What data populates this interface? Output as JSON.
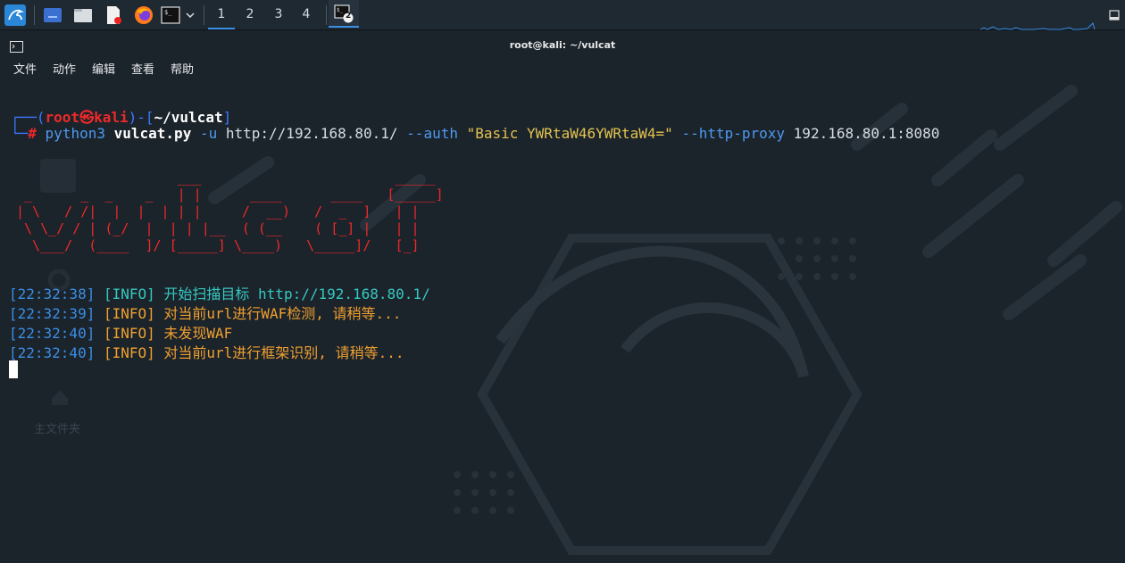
{
  "taskbar": {
    "workspaces": [
      "1",
      "2",
      "3",
      "4"
    ],
    "terminal_badge": "2",
    "icons": [
      "kali-dragon-icon",
      "desktop-icon",
      "file-manager-icon",
      "text-editor-icon",
      "firefox-icon",
      "terminal-icon",
      "chevron-down-icon",
      "terminal-task-icon"
    ]
  },
  "window": {
    "title": "root@kali: ~/vulcat",
    "icon": "terminal-window-icon"
  },
  "menu": [
    "文件",
    "动作",
    "编辑",
    "查看",
    "帮助"
  ],
  "prompt": {
    "corner_top": "┌──(",
    "user": "root",
    "skull": "㉿",
    "host": "kali",
    "mid": ")-[",
    "path": "~/vulcat",
    "end": "]",
    "corner_bottom": "└─",
    "hash": "#",
    "cmd": "python3",
    "script": "vulcat.py",
    "flag_u": "-u",
    "url": "http://192.168.80.1/",
    "flag_auth": "--auth",
    "auth_value": "\"Basic YWRtaW46YWRtaW4=\"",
    "flag_proxy": "--http-proxy",
    "proxy_value": "192.168.80.1:8080"
  },
  "banner": [
    "                    ___                        _____  ",
    " _      _  _    _   | |      ____      ____   [_____] ",
    "| \\   / /|  |  |  | | |     /  __)   /  _  ]   | |    ",
    " \\ \\_/ / | (_/  |  | | |__  ( (__    ( [_] |   | |    ",
    "  \\___/  (____  ]/ [_____] \\____)   \\_____]/   [_]    "
  ],
  "log": [
    {
      "ts": "[22:32:38]",
      "level": "[INFO]",
      "msg": "开始扫描目标 http://192.168.80.1/",
      "color": "cyan"
    },
    {
      "ts": "[22:32:39]",
      "level": "[INFO]",
      "msg": "对当前url进行WAF检测, 请稍等...",
      "color": "orange"
    },
    {
      "ts": "[22:32:40]",
      "level": "[INFO]",
      "msg": "未发现WAF",
      "color": "orange"
    },
    {
      "ts": "[22:32:40]",
      "level": "[INFO]",
      "msg": "对当前url进行框架识别, 请稍等...",
      "color": "orange"
    }
  ],
  "desktop": {
    "home_folder_label": "主文件夹"
  },
  "colors": {
    "background": "#1b232b",
    "accent": "#3a8ee6",
    "banner_red": "#ef2929"
  }
}
